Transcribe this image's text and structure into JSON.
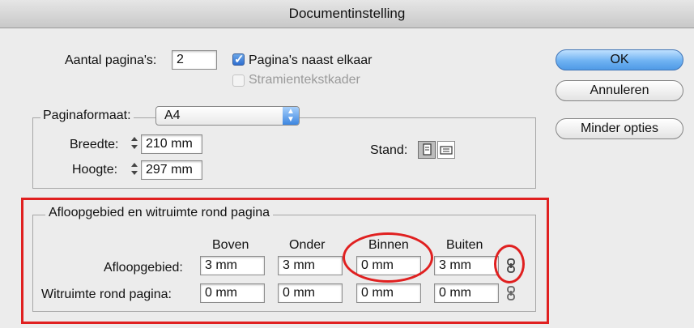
{
  "window": {
    "title": "Documentinstelling"
  },
  "top": {
    "pages_label": "Aantal pagina's:",
    "pages_value": "2",
    "facing_label": "Pagina's naast elkaar",
    "facing_checked": true,
    "master_label": "Stramientekstkader",
    "master_checked": false
  },
  "buttons": {
    "ok": "OK",
    "cancel": "Annuleren",
    "fewer": "Minder opties"
  },
  "page_size": {
    "label": "Paginaformaat:",
    "value": "A4",
    "width_label": "Breedte:",
    "width_value": "210 mm",
    "height_label": "Hoogte:",
    "height_value": "297 mm",
    "orientation_label": "Stand:",
    "orientation_selected": "portrait"
  },
  "bleed": {
    "legend": "Afloopgebied en witruimte rond pagina",
    "columns": [
      "Boven",
      "Onder",
      "Binnen",
      "Buiten"
    ],
    "rows": [
      {
        "label": "Afloopgebied:",
        "values": [
          "3 mm",
          "3 mm",
          "0 mm",
          "3 mm"
        ]
      },
      {
        "label": "Witruimte rond pagina:",
        "values": [
          "0 mm",
          "0 mm",
          "0 mm",
          "0 mm"
        ]
      }
    ]
  },
  "icons": {
    "chain": "chain-link-icon",
    "portrait": "portrait-icon",
    "landscape": "landscape-icon"
  },
  "colors": {
    "highlight": "#e02020",
    "accent": "#4f9ae6"
  }
}
